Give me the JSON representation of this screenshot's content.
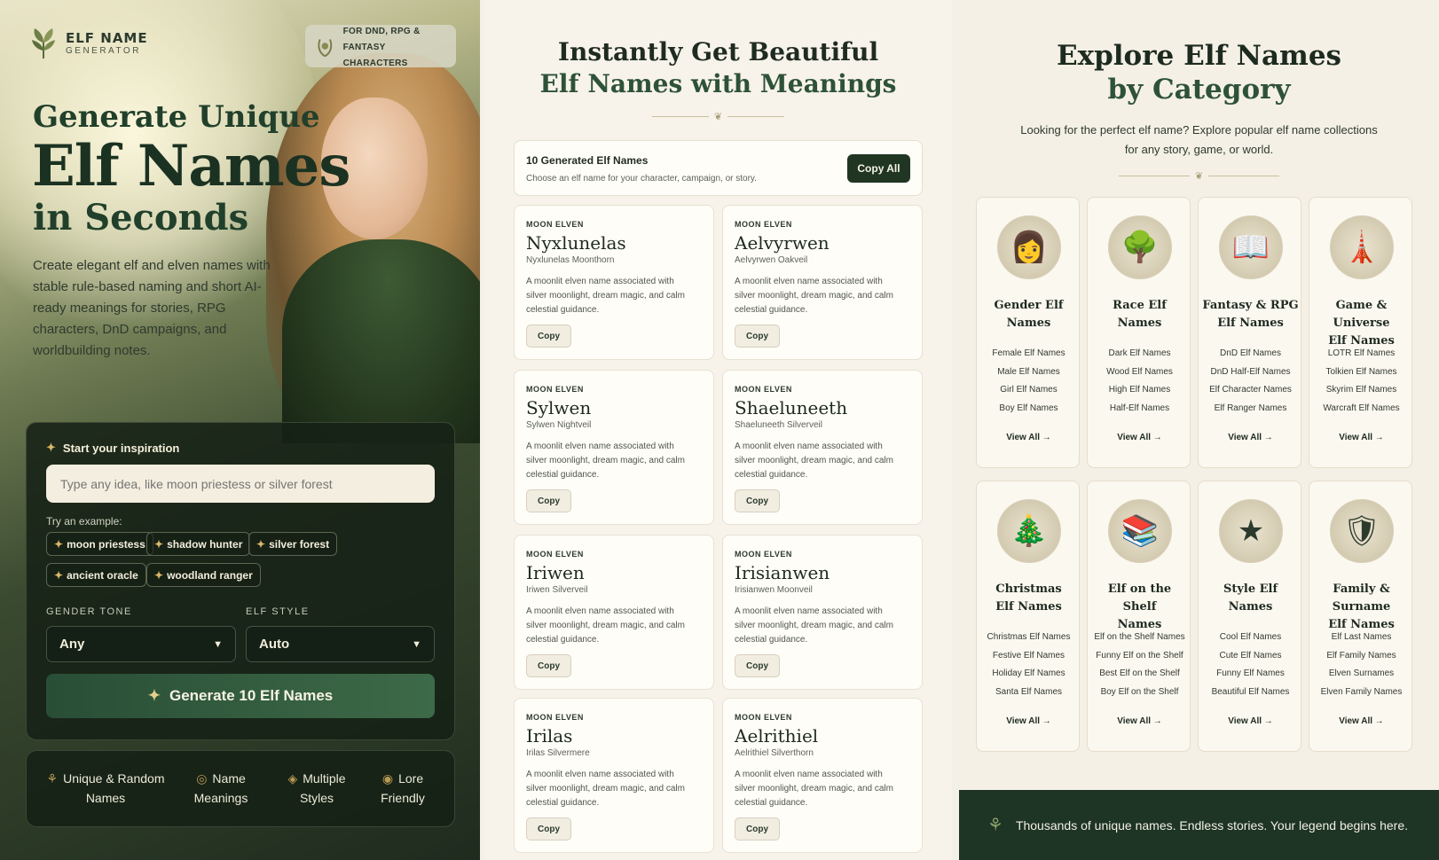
{
  "left": {
    "brand": {
      "title": "ELF NAME",
      "subtitle": "GENERATOR"
    },
    "badge": {
      "line1": "FOR DND, RPG &",
      "line2": "FANTASY CHARACTERS"
    },
    "hero": {
      "line1": "Generate Unique",
      "line2": "Elf Names",
      "line3": "in Seconds"
    },
    "description": "Create elegant elf and elven names with stable rule-based naming and short AI-ready meanings for stories, RPG characters, DnD campaigns, and worldbuilding notes.",
    "form": {
      "header": "Start your inspiration",
      "input_placeholder": "Type any idea, like moon priestess or silver forest",
      "try_label": "Try an example:",
      "examples": [
        "moon priestess",
        "shadow hunter",
        "silver forest",
        "ancient oracle",
        "woodland ranger"
      ],
      "gender_label": "GENDER TONE",
      "gender_value": "Any",
      "style_label": "ELF STYLE",
      "style_value": "Auto",
      "generate_label": "Generate 10 Elf Names"
    },
    "features": [
      {
        "l1": "Unique & Random",
        "l2": "Names"
      },
      {
        "l1": "Name",
        "l2": "Meanings"
      },
      {
        "l1": "Multiple",
        "l2": "Styles"
      },
      {
        "l1": "Lore",
        "l2": "Friendly"
      }
    ]
  },
  "middle": {
    "title1": "Instantly Get Beautiful",
    "title2": "Elf Names with Meanings",
    "generated": {
      "title": "10 Generated Elf Names",
      "desc": "Choose an elf name for your character, campaign, or story.",
      "copy_all": "Copy All"
    },
    "names": [
      {
        "tag": "MOON ELVEN",
        "name": "Nyxlunelas",
        "full": "Nyxlunelas Moonthorn",
        "desc": "A moonlit elven name associated with silver moonlight, dream magic, and calm celestial guidance.",
        "copy": "Copy"
      },
      {
        "tag": "MOON ELVEN",
        "name": "Aelvyrwen",
        "full": "Aelvyrwen Oakveil",
        "desc": "A moonlit elven name associated with silver moonlight, dream magic, and calm celestial guidance.",
        "copy": "Copy"
      },
      {
        "tag": "MOON ELVEN",
        "name": "Sylwen",
        "full": "Sylwen Nightveil",
        "desc": "A moonlit elven name associated with silver moonlight, dream magic, and calm celestial guidance.",
        "copy": "Copy"
      },
      {
        "tag": "MOON ELVEN",
        "name": "Shaeluneeth",
        "full": "Shaeluneeth Silverveil",
        "desc": "A moonlit elven name associated with silver moonlight, dream magic, and calm celestial guidance.",
        "copy": "Copy"
      },
      {
        "tag": "MOON ELVEN",
        "name": "Iriwen",
        "full": "Iriwen Silverveil",
        "desc": "A moonlit elven name associated with silver moonlight, dream magic, and calm celestial guidance.",
        "copy": "Copy"
      },
      {
        "tag": "MOON ELVEN",
        "name": "Irisianwen",
        "full": "Irisianwen Moonveil",
        "desc": "A moonlit elven name associated with silver moonlight, dream magic, and calm celestial guidance.",
        "copy": "Copy"
      },
      {
        "tag": "MOON ELVEN",
        "name": "Irilas",
        "full": "Irilas Silvermere",
        "desc": "A moonlit elven name associated with silver moonlight, dream magic, and calm celestial guidance.",
        "copy": "Copy"
      },
      {
        "tag": "MOON ELVEN",
        "name": "Aelrithiel",
        "full": "Aelrithiel Silverthorn",
        "desc": "A moonlit elven name associated with silver moonlight, dream magic, and calm celestial guidance.",
        "copy": "Copy"
      }
    ]
  },
  "right": {
    "title1": "Explore Elf Names",
    "title2": "by Category",
    "description": "Looking for the perfect elf name? Explore popular elf name collections for any story, game, or world.",
    "view_all": "View All →",
    "categories": [
      {
        "icon": "elf-portrait-icon",
        "glyph": "👩",
        "l1": "Gender Elf",
        "l2": "Names",
        "items": [
          "Female Elf Names",
          "Male Elf Names",
          "Girl Elf Names",
          "Boy Elf Names"
        ]
      },
      {
        "icon": "tree-icon",
        "glyph": "🌳",
        "l1": "Race Elf",
        "l2": "Names",
        "items": [
          "Dark Elf Names",
          "Wood Elf Names",
          "High Elf Names",
          "Half-Elf Names"
        ]
      },
      {
        "icon": "book-icon",
        "glyph": "📖",
        "l1": "Fantasy & RPG",
        "l2": "Elf Names",
        "items": [
          "DnD Elf Names",
          "DnD Half-Elf Names",
          "Elf Character Names",
          "Elf Ranger Names"
        ]
      },
      {
        "icon": "tower-icon",
        "glyph": "🗼",
        "l1": "Game & Universe",
        "l2": "Elf Names",
        "items": [
          "LOTR Elf Names",
          "Tolkien Elf Names",
          "Skyrim Elf Names",
          "Warcraft Elf Names"
        ]
      },
      {
        "icon": "christmas-tree-icon",
        "glyph": "🎄",
        "l1": "Christmas",
        "l2": "Elf Names",
        "items": [
          "Christmas Elf Names",
          "Festive Elf Names",
          "Holiday Elf Names",
          "Santa Elf Names"
        ]
      },
      {
        "icon": "bookshelf-icon",
        "glyph": "📚",
        "l1": "Elf on the Shelf",
        "l2": "Names",
        "items": [
          "Elf on the Shelf Names",
          "Funny Elf on the Shelf",
          "Best Elf on the Shelf",
          "Boy Elf on the Shelf"
        ]
      },
      {
        "icon": "star-emblem-icon",
        "glyph": "★",
        "l1": "Style Elf",
        "l2": "Names",
        "items": [
          "Cool Elf Names",
          "Cute Elf Names",
          "Funny Elf Names",
          "Beautiful Elf Names"
        ]
      },
      {
        "icon": "shield-icon",
        "glyph": "🛡",
        "l1": "Family & Surname",
        "l2": "Elf Names",
        "items": [
          "Elf Last Names",
          "Elf Family Names",
          "Elven Surnames",
          "Elven Family Names"
        ]
      }
    ],
    "footer": "Thousands of unique names. Endless stories. Your legend begins here."
  }
}
